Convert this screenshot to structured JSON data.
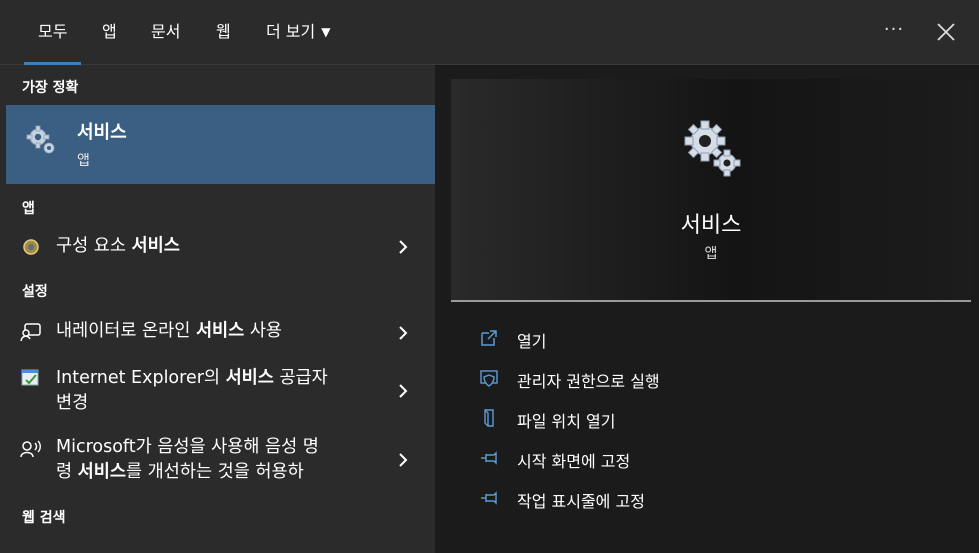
{
  "tabs": [
    {
      "label": "모두",
      "active": true
    },
    {
      "label": "앱"
    },
    {
      "label": "문서"
    },
    {
      "label": "웹"
    },
    {
      "label": "더 보기"
    }
  ],
  "more_options_label": "···",
  "sections": {
    "best_match": "가장 정확",
    "apps": "앱",
    "settings": "설정",
    "web_search": "웹 검색"
  },
  "best_match": {
    "title": "서비스",
    "subtitle": "앱",
    "icon": "services-gear-icon"
  },
  "apps_items": [
    {
      "pre": "구성 요소 ",
      "bold": "서비스",
      "post": "",
      "icon": "component-services-icon"
    }
  ],
  "settings_items": [
    {
      "line1_pre": "내레이터로 온라인 ",
      "line1_bold": "서비스",
      "line1_post": " 사용",
      "icon": "narrator-icon"
    },
    {
      "line1_pre": "Internet Explorer의 ",
      "line1_bold": "서비스",
      "line1_post": " 공급자",
      "line2": "변경",
      "icon": "internet-explorer-settings-icon"
    },
    {
      "line1": "Microsoft가 음성을 사용해 음성 명",
      "line2_pre": "령 ",
      "line2_bold": "서비스",
      "line2_post": "를 개선하는 것을 허용하",
      "icon": "speech-icon"
    }
  ],
  "detail": {
    "title": "서비스",
    "type": "앱",
    "actions": [
      {
        "label": "열기",
        "icon": "open-icon"
      },
      {
        "label": "관리자 권한으로 실행",
        "icon": "run-as-admin-shield-icon"
      },
      {
        "label": "파일 위치 열기",
        "icon": "open-file-location-icon"
      },
      {
        "label": "시작 화면에 고정",
        "icon": "pin-to-start-icon"
      },
      {
        "label": "작업 표시줄에 고정",
        "icon": "pin-to-taskbar-icon"
      }
    ]
  },
  "colors": {
    "accent": "#3d7fbd",
    "selected_row": "#3a5f82",
    "background": "#2b2b2b"
  }
}
